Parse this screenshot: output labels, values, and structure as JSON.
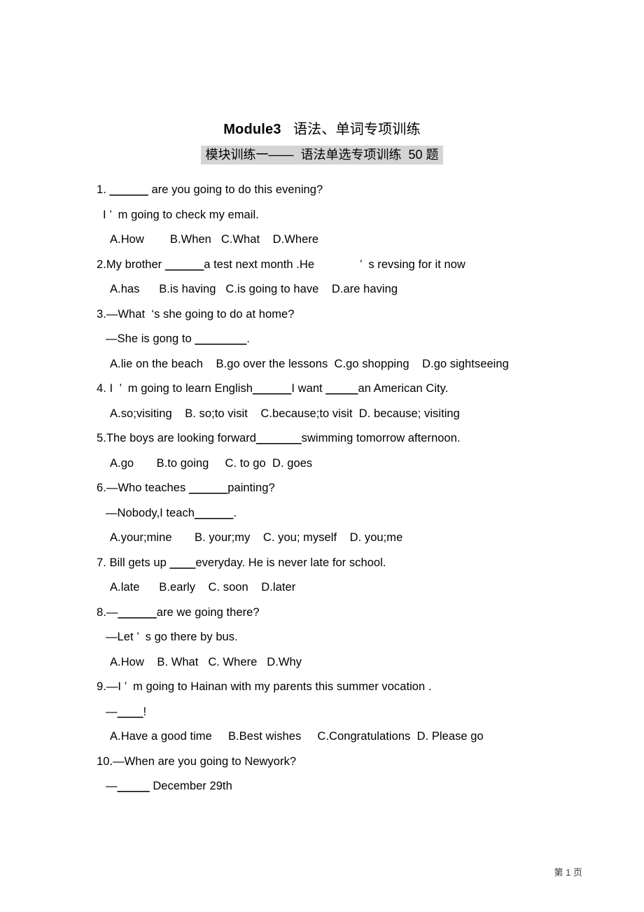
{
  "document": {
    "title_en": "Module3",
    "title_gap": "   ",
    "title_cn": "语法、单词专项训练",
    "subtitle": "模块训练一——  语法单选专项训练  50 题",
    "footer": "第 1 页"
  },
  "questions": [
    {
      "number": "1",
      "stem_pre": "1. ",
      "blank1": "______",
      "stem_post": " are you going to do this evening?",
      "reply": "I ’  m going to check my email.",
      "options": "A.How        B.When   C.What    D.Where"
    },
    {
      "number": "2",
      "stem_pre": "2.My brother ",
      "blank1": "______",
      "stem_post": "a test next month .He              ’  s revsing for it now",
      "options": "A.has      B.is having   C.is going to have    D.are having"
    },
    {
      "number": "3",
      "stem": "3.—What  ‘s she going to do at home?",
      "reply_pre": "—She is gong to ",
      "blank1": "________",
      "reply_post": ".",
      "options": "A.lie on the beach    B.go over the lessons  C.go shopping    D.go sightseeing"
    },
    {
      "number": "4",
      "stem_pre": "4. I  ’  m going to learn English",
      "blank1": "______",
      "stem_mid": "I want ",
      "blank2": "_____",
      "stem_post": "an American City.",
      "options": "A.so;visiting    B. so;to visit    C.because;to visit  D. because; visiting"
    },
    {
      "number": "5",
      "stem_pre": "5.The boys are looking forward",
      "blank1": "_______",
      "stem_post": "swimming tomorrow afternoon.",
      "options": "A.go       B.to going     C. to go  D. goes"
    },
    {
      "number": "6",
      "stem_pre": "6.—Who teaches ",
      "blank1": "______",
      "stem_post": "painting?",
      "reply_pre": "—Nobody,I teach",
      "blank2": "______",
      "reply_post": ".",
      "options": "A.your;mine       B. your;my    C. you; myself    D. you;me"
    },
    {
      "number": "7",
      "stem_pre": "7. Bill gets up ",
      "blank1": "____",
      "stem_post": "everyday. He is never late for school.",
      "options": "A.late      B.early    C. soon    D.later"
    },
    {
      "number": "8",
      "stem_pre": "8.—",
      "blank1": "______",
      "stem_post": "are we going there?",
      "reply": "—Let ’  s go there by bus.",
      "options": "A.How    B. What   C. Where   D.Why"
    },
    {
      "number": "9",
      "stem": "9.—I ’  m going to Hainan with my parents this summer vocation .",
      "reply_pre": "—",
      "blank1": "____",
      "reply_post": "!",
      "options": "A.Have a good time     B.Best wishes     C.Congratulations  D. Please go"
    },
    {
      "number": "10",
      "stem": "10.—When are you going to Newyork?",
      "reply_pre": "—",
      "blank1": "_____",
      "reply_post": " December 29th"
    }
  ]
}
